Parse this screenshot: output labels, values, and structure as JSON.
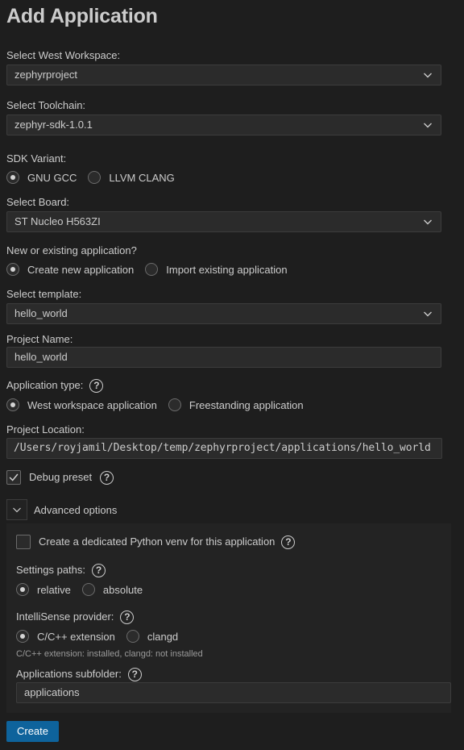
{
  "page": {
    "title": "Add Application"
  },
  "workspace": {
    "label": "Select West Workspace:",
    "value": "zephyrproject"
  },
  "toolchain": {
    "label": "Select Toolchain:",
    "value": "zephyr-sdk-1.0.1"
  },
  "sdk_variant": {
    "label": "SDK Variant:",
    "options": [
      {
        "label": "GNU GCC",
        "selected": true
      },
      {
        "label": "LLVM CLANG",
        "selected": false
      }
    ]
  },
  "board": {
    "label": "Select Board:",
    "value": "ST Nucleo H563ZI"
  },
  "app_mode": {
    "label": "New or existing application?",
    "options": [
      {
        "label": "Create new application",
        "selected": true
      },
      {
        "label": "Import existing application",
        "selected": false
      }
    ]
  },
  "template": {
    "label": "Select template:",
    "value": "hello_world"
  },
  "project_name": {
    "label": "Project Name:",
    "value": "hello_world"
  },
  "app_type": {
    "label": "Application type:",
    "options": [
      {
        "label": "West workspace application",
        "selected": true
      },
      {
        "label": "Freestanding application",
        "selected": false
      }
    ]
  },
  "project_location": {
    "label": "Project Location:",
    "value": "/Users/royjamil/Desktop/temp/zephyrproject/applications/hello_world"
  },
  "debug_preset": {
    "label": "Debug preset",
    "checked": true
  },
  "advanced": {
    "label": "Advanced options",
    "python_venv": {
      "label": "Create a dedicated Python venv for this application",
      "checked": false
    },
    "settings_paths": {
      "label": "Settings paths:",
      "options": [
        {
          "label": "relative",
          "selected": true
        },
        {
          "label": "absolute",
          "selected": false
        }
      ]
    },
    "intellisense": {
      "label": "IntelliSense provider:",
      "options": [
        {
          "label": "C/C++ extension",
          "selected": true
        },
        {
          "label": "clangd",
          "selected": false
        }
      ],
      "hint": "C/C++ extension: installed, clangd: not installed"
    },
    "subfolder": {
      "label": "Applications subfolder:",
      "value": "applications"
    }
  },
  "actions": {
    "create_label": "Create"
  },
  "icons": {
    "help": "question-circle-icon",
    "chevron": "chevron-down-icon",
    "check": "checkmark-icon"
  },
  "colors": {
    "background": "#1e1e1e",
    "primary_button": "#0e639c",
    "input_bg": "#2b2b2b"
  }
}
